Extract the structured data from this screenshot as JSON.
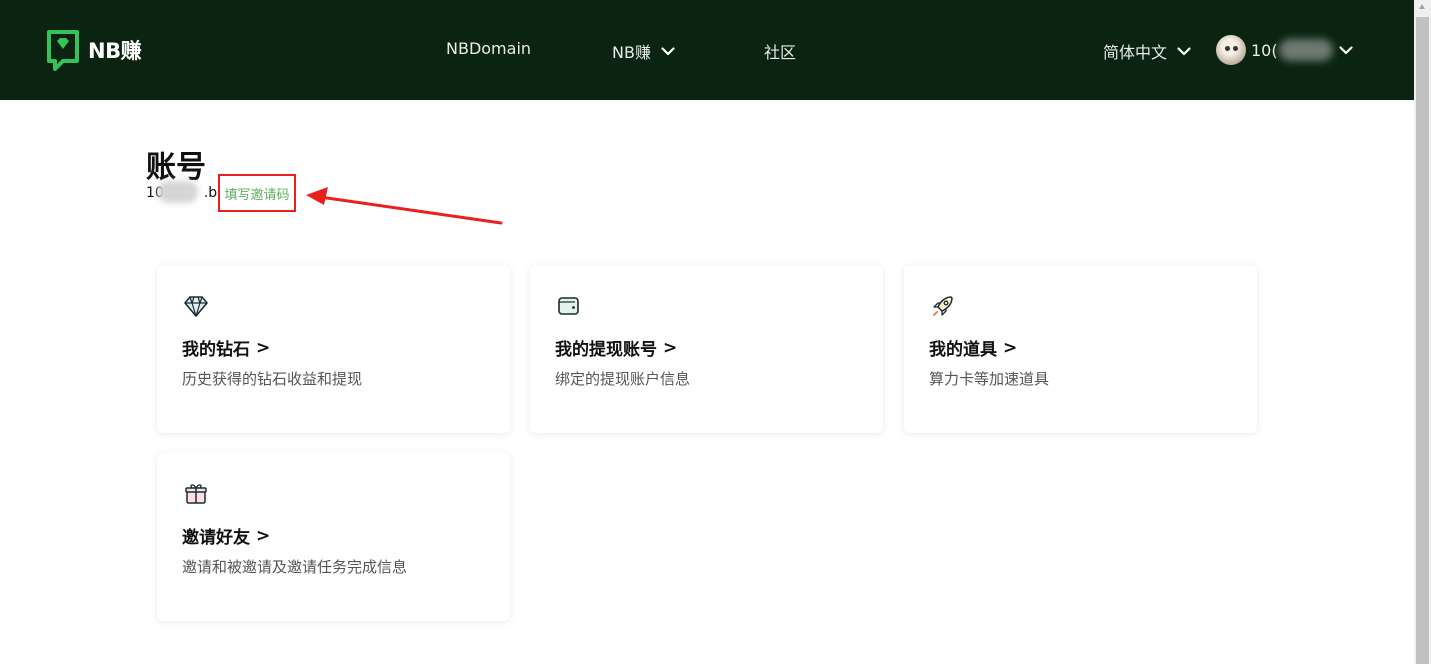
{
  "header": {
    "logo_text": "NB赚",
    "nav": [
      {
        "label": "NBDomain"
      },
      {
        "label": "NB赚"
      },
      {
        "label": "社区"
      }
    ],
    "language": "简体中文",
    "user": {
      "name_visible": "10("
    }
  },
  "account": {
    "title": "账号",
    "id_visible_prefix": "10",
    "id_visible_suffix": ".b",
    "invite_link": "填写邀请码"
  },
  "cards": [
    {
      "title": "我的钻石",
      "desc": "历史获得的钻石收益和提现",
      "icon": "diamond-icon"
    },
    {
      "title": "我的提现账号",
      "desc": "绑定的提现账户信息",
      "icon": "wallet-icon"
    },
    {
      "title": "我的道具",
      "desc": "算力卡等加速道具",
      "icon": "rocket-icon"
    },
    {
      "title": "邀请好友",
      "desc": "邀请和被邀请及邀请任务完成信息",
      "icon": "gift-icon"
    }
  ],
  "colors": {
    "header_bg": "#0b2411",
    "brand_green": "#36c25a",
    "link_green": "#5faf5c",
    "annotation_red": "#e8211c"
  }
}
